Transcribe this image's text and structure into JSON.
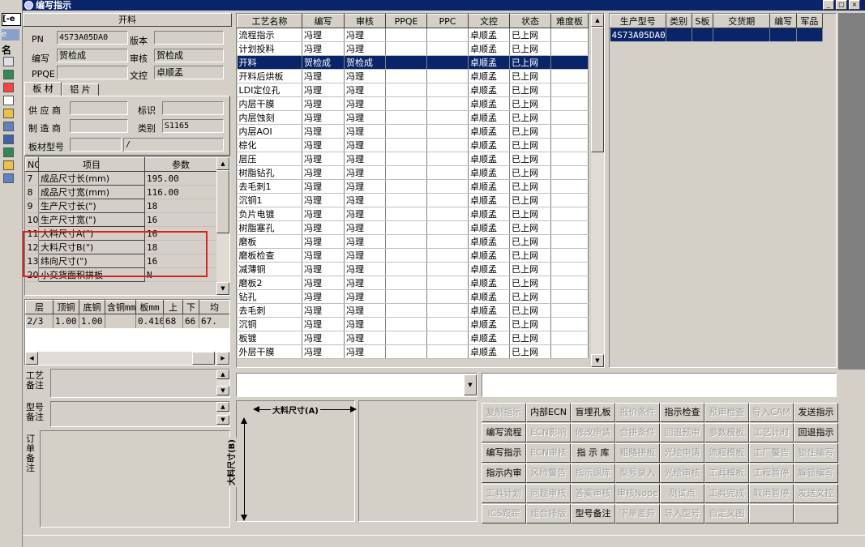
{
  "window": {
    "title": "编写指示"
  },
  "left_taskbar": {
    "top_label": "[-e",
    "second_label": "e",
    "third_label": "名"
  },
  "header_panel": {
    "section_title": "开料",
    "pn_label": "PN",
    "pn_value": "4S73A05DA0",
    "version_label": "版本",
    "version_value": "",
    "writer_label": "编写",
    "writer_value": "贺检成",
    "reviewer_label": "审核",
    "reviewer_value": "贺检成",
    "ppqe_label": "PPQE",
    "ppqe_value": "",
    "doc_label": "文控",
    "doc_value": "卓顺孟"
  },
  "material_tabs": [
    "板 材",
    "铝 片"
  ],
  "material": {
    "supplier_label": "供 应 商",
    "supplier_value": "",
    "mark_label": "标识",
    "mark_value": "",
    "maker_label": "制 造 商",
    "maker_value": "",
    "category_label": "类别",
    "category_value": "S1165",
    "board_type_label": "板材型号",
    "board_type_value": "",
    "board_type_value2": "/"
  },
  "param_table": {
    "headers": [
      "NO",
      "项目",
      "参数"
    ],
    "rows": [
      {
        "no": "7",
        "item": "成品尺寸长(mm)",
        "value": "195.00"
      },
      {
        "no": "8",
        "item": "成品尺寸宽(mm)",
        "value": "116.00"
      },
      {
        "no": "9",
        "item": "生产尺寸长(\")",
        "value": "18"
      },
      {
        "no": "10",
        "item": "生产尺寸宽(\")",
        "value": "16"
      },
      {
        "no": "11",
        "item": "大料尺寸A(\")",
        "value": "16"
      },
      {
        "no": "12",
        "item": "大料尺寸B(\")",
        "value": "18"
      },
      {
        "no": "13",
        "item": "纬向尺寸(\")",
        "value": "16"
      },
      {
        "no": "20",
        "item": "小交货面积拼板",
        "value": "N"
      }
    ],
    "highlight_color": "#e02020"
  },
  "layer_table": {
    "headers": [
      "层",
      "顶铜",
      "底铜",
      "含铜mm",
      "板mm",
      "上",
      "下",
      "均"
    ],
    "rows": [
      [
        "2/3",
        "1.00",
        "1.00",
        "",
        "0.410",
        "68",
        "66",
        "67."
      ]
    ]
  },
  "notes": {
    "craft_label": "工艺备注",
    "model_label": "型号备注",
    "order_label": "订单备注"
  },
  "process_table": {
    "headers": [
      "工艺名称",
      "编写",
      "审核",
      "PPQE",
      "PPC",
      "文控",
      "状态",
      "难度板"
    ],
    "rows": [
      [
        "流程指示",
        "冯理",
        "冯理",
        "",
        "",
        "卓顺孟",
        "已上网",
        ""
      ],
      [
        "计划投料",
        "冯理",
        "冯理",
        "",
        "",
        "卓顺孟",
        "已上网",
        ""
      ],
      [
        "开料",
        "贺检成",
        "贺检成",
        "",
        "",
        "卓顺孟",
        "已上网",
        ""
      ],
      [
        "开料后烘板",
        "冯理",
        "冯理",
        "",
        "",
        "卓顺孟",
        "已上网",
        ""
      ],
      [
        "LDI定位孔",
        "冯理",
        "冯理",
        "",
        "",
        "卓顺孟",
        "已上网",
        ""
      ],
      [
        "内层干膜",
        "冯理",
        "冯理",
        "",
        "",
        "卓顺孟",
        "已上网",
        ""
      ],
      [
        "内层蚀刻",
        "冯理",
        "冯理",
        "",
        "",
        "卓顺孟",
        "已上网",
        ""
      ],
      [
        "内层AOI",
        "冯理",
        "冯理",
        "",
        "",
        "卓顺孟",
        "已上网",
        ""
      ],
      [
        "棕化",
        "冯理",
        "冯理",
        "",
        "",
        "卓顺孟",
        "已上网",
        ""
      ],
      [
        "层压",
        "冯理",
        "冯理",
        "",
        "",
        "卓顺孟",
        "已上网",
        ""
      ],
      [
        "树脂钻孔",
        "冯理",
        "冯理",
        "",
        "",
        "卓顺孟",
        "已上网",
        ""
      ],
      [
        "去毛刺1",
        "冯理",
        "冯理",
        "",
        "",
        "卓顺孟",
        "已上网",
        ""
      ],
      [
        "沉铜1",
        "冯理",
        "冯理",
        "",
        "",
        "卓顺孟",
        "已上网",
        ""
      ],
      [
        "负片电镀",
        "冯理",
        "冯理",
        "",
        "",
        "卓顺孟",
        "已上网",
        ""
      ],
      [
        "树脂塞孔",
        "冯理",
        "冯理",
        "",
        "",
        "卓顺孟",
        "已上网",
        ""
      ],
      [
        "磨板",
        "冯理",
        "冯理",
        "",
        "",
        "卓顺孟",
        "已上网",
        ""
      ],
      [
        "磨板检查",
        "冯理",
        "冯理",
        "",
        "",
        "卓顺孟",
        "已上网",
        ""
      ],
      [
        "减薄铜",
        "冯理",
        "冯理",
        "",
        "",
        "卓顺孟",
        "已上网",
        ""
      ],
      [
        "磨板2",
        "冯理",
        "冯理",
        "",
        "",
        "卓顺孟",
        "已上网",
        ""
      ],
      [
        "钻孔",
        "冯理",
        "冯理",
        "",
        "",
        "卓顺孟",
        "已上网",
        ""
      ],
      [
        "去毛刺",
        "冯理",
        "冯理",
        "",
        "",
        "卓顺孟",
        "已上网",
        ""
      ],
      [
        "沉铜",
        "冯理",
        "冯理",
        "",
        "",
        "卓顺孟",
        "已上网",
        ""
      ],
      [
        "板镀",
        "冯理",
        "冯理",
        "",
        "",
        "卓顺孟",
        "已上网",
        ""
      ],
      [
        "外层干膜",
        "冯理",
        "冯理",
        "",
        "",
        "卓顺孟",
        "已上网",
        ""
      ]
    ],
    "selected_index": 2
  },
  "model_table": {
    "headers": [
      "生产型号",
      "类别",
      "S板",
      "交货期",
      "编写",
      "军品"
    ],
    "rows": [
      [
        "4S73A05DA0",
        "",
        "",
        "",
        "",
        ""
      ]
    ]
  },
  "diagram": {
    "a_label": "大料尺寸(A)",
    "b_label": "大料尺寸(B)"
  },
  "buttons": [
    [
      {
        "label": "复制指示",
        "enabled": false
      },
      {
        "label": "内部ECN",
        "enabled": true
      },
      {
        "label": "盲埋孔板",
        "enabled": true
      },
      {
        "label": "报价条件",
        "enabled": false
      },
      {
        "label": "指示检查",
        "enabled": true
      },
      {
        "label": "预审检查",
        "enabled": false
      },
      {
        "label": "导入CAM",
        "enabled": false
      },
      {
        "label": "发送指示",
        "enabled": true
      }
    ],
    [
      {
        "label": "编写流程",
        "enabled": true
      },
      {
        "label": "ECN影响",
        "enabled": false
      },
      {
        "label": "修改申请",
        "enabled": false
      },
      {
        "label": "合拼条件",
        "enabled": false
      },
      {
        "label": "回退预审",
        "enabled": false
      },
      {
        "label": "参数模板",
        "enabled": false
      },
      {
        "label": "工艺计时",
        "enabled": false
      },
      {
        "label": "回退指示",
        "enabled": true
      }
    ],
    [
      {
        "label": "编写指示",
        "enabled": true
      },
      {
        "label": "ECN审核",
        "enabled": false
      },
      {
        "label": "指 示 库",
        "enabled": true
      },
      {
        "label": "粗略拼板",
        "enabled": false
      },
      {
        "label": "光绘申请",
        "enabled": false
      },
      {
        "label": "流程模板",
        "enabled": false
      },
      {
        "label": "工厂警告",
        "enabled": false
      },
      {
        "label": "锁住编写",
        "enabled": false
      }
    ],
    [
      {
        "label": "指示内审",
        "enabled": true
      },
      {
        "label": "风险警告",
        "enabled": false
      },
      {
        "label": "指示退库",
        "enabled": false
      },
      {
        "label": "型号录入",
        "enabled": false
      },
      {
        "label": "光绘审核",
        "enabled": false
      },
      {
        "label": "工具模板",
        "enabled": false
      },
      {
        "label": "工程暂停",
        "enabled": false
      },
      {
        "label": "解锁编写",
        "enabled": false
      }
    ],
    [
      {
        "label": "工具计划",
        "enabled": false
      },
      {
        "label": "问题审核",
        "enabled": false
      },
      {
        "label": "答案审核",
        "enabled": false
      },
      {
        "label": "审核Nope",
        "enabled": false
      },
      {
        "label": "测试点",
        "enabled": false
      },
      {
        "label": "工具完成",
        "enabled": false
      },
      {
        "label": "取消暂停",
        "enabled": false
      },
      {
        "label": "发送文控",
        "enabled": false
      }
    ],
    [
      {
        "label": "ICS跟踪",
        "enabled": false
      },
      {
        "label": "组合排版",
        "enabled": false
      },
      {
        "label": "型号备注",
        "enabled": true
      },
      {
        "label": "下单差异",
        "enabled": false
      },
      {
        "label": "导入型号",
        "enabled": false
      },
      {
        "label": "自定义图",
        "enabled": false
      },
      {
        "label": "",
        "enabled": false
      },
      {
        "label": "",
        "enabled": false
      }
    ]
  ]
}
